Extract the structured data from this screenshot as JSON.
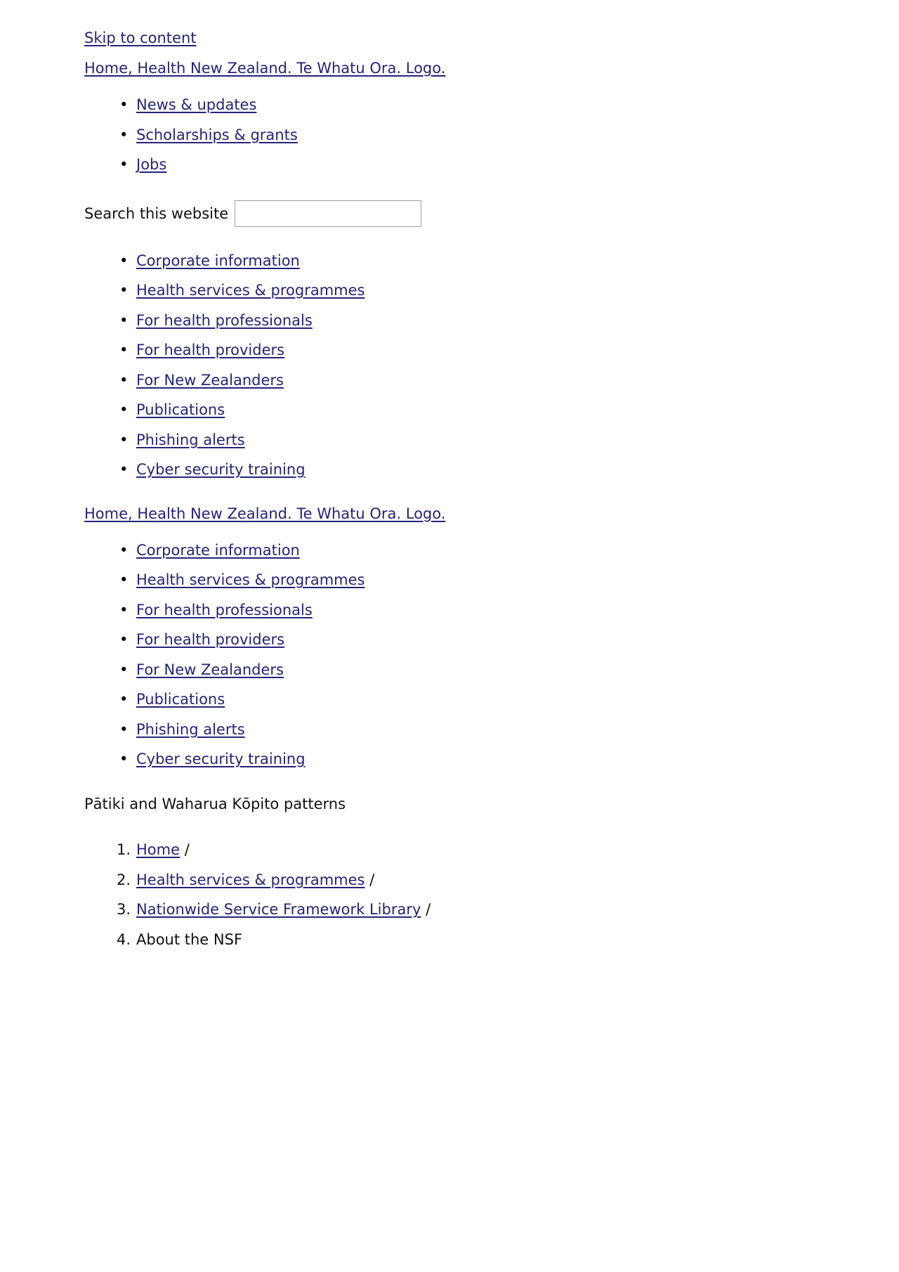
{
  "skip": {
    "label": "Skip to content "
  },
  "logo_link": {
    "label": "Home, Health New Zealand. Te Whatu Ora. Logo. "
  },
  "utility_nav": {
    "items": [
      {
        "label": "News & updates "
      },
      {
        "label": "Scholarships & grants "
      },
      {
        "label": "Jobs "
      }
    ]
  },
  "search": {
    "label": "Search this website",
    "value": "",
    "placeholder": ""
  },
  "primary_nav": {
    "items": [
      {
        "label": "Corporate information "
      },
      {
        "label": "Health services & programmes "
      },
      {
        "label": "For health professionals "
      },
      {
        "label": "For health providers "
      },
      {
        "label": "For New Zealanders "
      },
      {
        "label": "Publications "
      },
      {
        "label": "Phishing alerts "
      },
      {
        "label": "Cyber security training "
      }
    ]
  },
  "logo_link_2": {
    "label": "Home, Health New Zealand. Te Whatu Ora. Logo. "
  },
  "secondary_nav": {
    "items": [
      {
        "label": "Corporate information"
      },
      {
        "label": "Health services & programmes"
      },
      {
        "label": "For health professionals"
      },
      {
        "label": "For health providers"
      },
      {
        "label": "For New Zealanders"
      },
      {
        "label": "Publications"
      },
      {
        "label": "Phishing alerts"
      },
      {
        "label": "Cyber security training"
      }
    ]
  },
  "patterns": {
    "label": "Pātiki and Waharua Kōpito patterns"
  },
  "breadcrumb": {
    "items": [
      {
        "label": "Home",
        "separator": " /",
        "is_link": true
      },
      {
        "label": "Health services & programmes",
        "separator": " /",
        "is_link": true
      },
      {
        "label": "Nationwide Service Framework Library",
        "separator": " /",
        "is_link": true
      },
      {
        "label": "About the NSF",
        "separator": "",
        "is_link": false
      }
    ]
  },
  "colors": {
    "link": "#24247a",
    "text": "#111111",
    "input_border": "#a0a0a0",
    "background": "#ffffff"
  }
}
